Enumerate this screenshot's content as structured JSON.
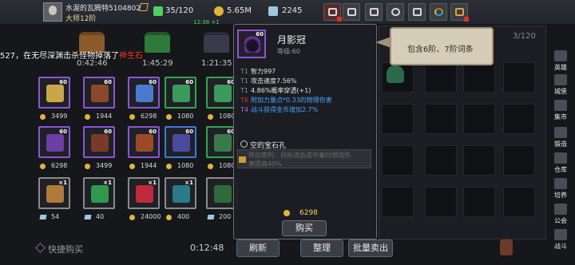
{
  "player": {
    "name": "水渥的瓦腾特5104802",
    "rank": "大师12阶"
  },
  "resources": [
    {
      "id": "bag-capacity",
      "value": "35/120",
      "icon": "bag-icon",
      "color": "#4fcf5f"
    },
    {
      "id": "gold",
      "value": "5.65M",
      "icon": "gold-coin-icon",
      "color": "#e3b33b"
    },
    {
      "id": "gems",
      "value": "2245",
      "icon": "diamond-icon",
      "color": "#9fc7e0"
    }
  ],
  "resource_sub": {
    "gold_rate": "12:38 +1"
  },
  "topbar_buttons": [
    {
      "name": "shop-button",
      "icon": "shop-icon"
    },
    {
      "name": "mail-button",
      "icon": "mail-icon"
    },
    {
      "name": "gamepad-button",
      "icon": "gamepad-icon"
    },
    {
      "name": "settings-button",
      "icon": "gear-icon"
    },
    {
      "name": "grid-button",
      "icon": "grid-icon"
    },
    {
      "name": "event-button",
      "icon": "rainbow-icon"
    },
    {
      "name": "gift-button",
      "icon": "gift-icon"
    }
  ],
  "chests": [
    {
      "name": "chest-brown",
      "timer": "0:42:46",
      "color": "#8a5a2a"
    },
    {
      "name": "chest-green",
      "timer": "1:45:29",
      "color": "#2f7a3a"
    },
    {
      "name": "chest-dark",
      "timer": "1:21:35",
      "color": "#3a3a4a"
    }
  ],
  "broadcast": {
    "prefix": "527，在无尽深渊击杀怪物掉落了",
    "item": "神生石"
  },
  "shop_items": [
    {
      "level": "60",
      "price": "3499",
      "currency": "coin",
      "border": "#8d55d6",
      "glyph": "staff-icon",
      "glyph_color": "#c9a64a"
    },
    {
      "level": "60",
      "price": "1944",
      "currency": "coin",
      "border": "#8d55d6",
      "glyph": "book-icon",
      "glyph_color": "#8a4a2a"
    },
    {
      "level": "60",
      "price": "6298",
      "currency": "coin",
      "border": "#8d55d6",
      "glyph": "dagger-icon",
      "glyph_color": "#4a7ad0"
    },
    {
      "level": "60",
      "price": "1080",
      "currency": "coin",
      "border": "#2fa84a",
      "glyph": "sword-icon",
      "glyph_color": "#3a9a5a"
    },
    {
      "level": "60",
      "price": "1080",
      "currency": "coin",
      "border": "#2fa84a",
      "glyph": "bow-icon",
      "glyph_color": "#3a9a5a"
    },
    {
      "level": "60",
      "price": "6298",
      "currency": "coin",
      "border": "#8d55d6",
      "glyph": "helmet-icon",
      "glyph_color": "#6d3ea3"
    },
    {
      "level": "60",
      "price": "3499",
      "currency": "coin",
      "border": "#8d55d6",
      "glyph": "armor-icon",
      "glyph_color": "#7a3a2a"
    },
    {
      "level": "60",
      "price": "1944",
      "currency": "coin",
      "border": "#8d55d6",
      "glyph": "boots-icon",
      "glyph_color": "#9a4a2a"
    },
    {
      "level": "60",
      "price": "1080",
      "currency": "coin",
      "border": "#3f7ad6",
      "glyph": "pants-icon",
      "glyph_color": "#4a4aa0"
    },
    {
      "level": "60",
      "price": "1080",
      "currency": "coin",
      "border": "#2fa84a",
      "glyph": "greaves-icon",
      "glyph_color": "#3a7a4a"
    },
    {
      "level": "×1",
      "price": "54",
      "currency": "gem",
      "border": "#8a8a8a",
      "glyph": "spellbook-icon",
      "glyph_color": "#b07a3a"
    },
    {
      "level": "×1",
      "price": "40",
      "currency": "gem",
      "border": "#8a8a8a",
      "glyph": "green-gem-icon",
      "glyph_color": "#2f9a4a"
    },
    {
      "level": "×1",
      "price": "24000",
      "currency": "coin",
      "border": "#8a8a8a",
      "glyph": "red-gem-icon",
      "glyph_color": "#c02a3a"
    },
    {
      "level": "×1",
      "price": "400",
      "currency": "coin",
      "border": "#8a8a8a",
      "glyph": "scroll-book-icon",
      "glyph_color": "#2a7a8a"
    },
    {
      "level": "",
      "price": "200",
      "currency": "gem",
      "border": "#8a8a8a",
      "glyph": "chest-icon",
      "glyph_color": "#2f6a3a"
    }
  ],
  "bottom": {
    "quickbuy": "快捷购买",
    "timer": "0:12:48",
    "refresh": "刷新",
    "organize": "整理",
    "bulk_sell": "批量卖出"
  },
  "tooltip": {
    "name": "月影冠",
    "level_label": "等级:60",
    "icon_level": "60",
    "stats": [
      {
        "tier": "T1",
        "tier_color": "gray",
        "text": "智力997",
        "color": "norm"
      },
      {
        "tier": "T1",
        "tier_color": "gray",
        "text": "攻击速度7.56%",
        "color": "norm"
      },
      {
        "tier": "T1",
        "tier_color": "gray",
        "text": "4.86%概率穿透(+1)",
        "color": "norm"
      },
      {
        "tier": "T6",
        "tier_color": "red",
        "text": "附加力量点*0.33的物理伤害",
        "color": "blue"
      },
      {
        "tier": "T4",
        "tier_color": "pur",
        "text": "战斗获得金币增加2.7%",
        "color": "blue"
      }
    ],
    "socket": "空的宝石孔",
    "set_line1": "熟焰审判：目标流血或中毒时燃烧伤",
    "set_line2": "害提高40%",
    "price": "6298",
    "buy": "购买"
  },
  "bubble": {
    "text": "包含6阶、7阶词条"
  },
  "bag": {
    "count": "3/120"
  },
  "side_menu": [
    {
      "label": "英雄",
      "icon": "hero-icon"
    },
    {
      "label": "城堡",
      "icon": "castle-icon"
    },
    {
      "label": "集市",
      "icon": "market-icon"
    },
    {
      "label": "锻造",
      "icon": "forge-icon"
    },
    {
      "label": "仓库",
      "icon": "warehouse-icon"
    },
    {
      "label": "培养",
      "icon": "training-icon"
    },
    {
      "label": "公会",
      "icon": "guild-icon"
    },
    {
      "label": "战斗",
      "icon": "battle-icon"
    }
  ]
}
